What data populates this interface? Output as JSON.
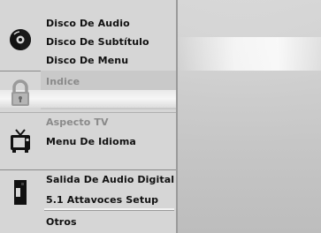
{
  "menu": {
    "audio_group": {
      "items": [
        "Disco De Audio",
        "Disco De Subtítulo",
        "Disco De Menu"
      ],
      "icon": "disc-icon"
    },
    "lock_group": {
      "items": [
        "Indice"
      ],
      "icon": "padlock-icon"
    },
    "tv_group": {
      "items": [
        "Aspecto TV",
        "Menu De Idioma"
      ],
      "icon": "tv-icon"
    },
    "output_group": {
      "items": [
        "Salida De Audio Digital",
        "5.1 Attavoces Setup",
        "Otros"
      ],
      "icon": "speaker-icon"
    }
  }
}
